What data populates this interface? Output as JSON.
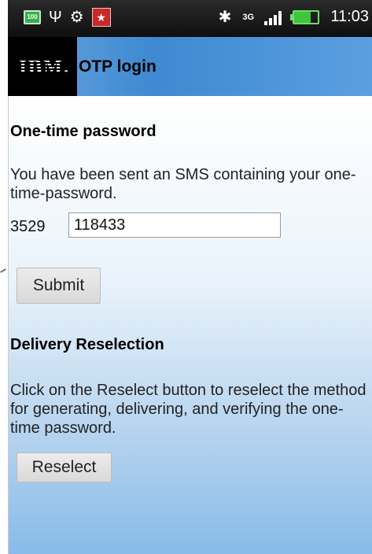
{
  "status_bar": {
    "battery_level_text": "100",
    "usb_icon": "usb-icon",
    "android_icon": "android-debug-icon",
    "notification_icon": "notification-app-icon",
    "bluetooth_icon": "bluetooth-icon",
    "network_type": "3G",
    "signal_icon": "signal-strength-icon",
    "battery_icon": "battery-icon",
    "time": "11:03"
  },
  "header": {
    "logo_text": "IBM.",
    "title": "OTP login"
  },
  "otp_section": {
    "heading": "One-time password",
    "message": "You have been sent an SMS containing your one-time-password.",
    "prefix": "3529",
    "otp_value": "118433",
    "submit_label": "Submit"
  },
  "reselect_section": {
    "heading": "Delivery Reselection",
    "message": "Click on the Reselect button to reselect the method for generating, delivering, and verifying the one-time password.",
    "reselect_label": "Reselect"
  },
  "colors": {
    "header_blue": "#3e89d1",
    "status_bar": "#1a1a1a",
    "battery_green": "#3ec63e"
  }
}
